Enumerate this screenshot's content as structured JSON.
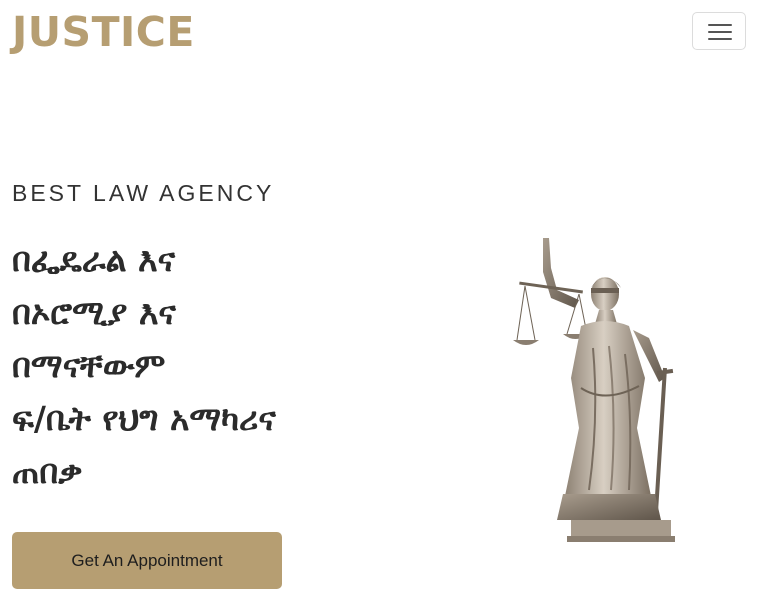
{
  "navbar": {
    "brand": "JUSTICE",
    "menu_toggle_icon": "hamburger-menu-icon"
  },
  "hero": {
    "eyebrow": "BEST LAW AGENCY",
    "headline_lines": [
      "በፌዴራል እና",
      "በኦሮሚያ እና",
      "በማናቸውም",
      "ፍ/ቤት የህግ አማካሪና",
      "ጠበቃ"
    ],
    "cta_label": "Get An Appointment",
    "image_subject": "lady-justice-statue"
  },
  "colors": {
    "brand_gold": "#b69e72",
    "text_dark": "#2b2b2b",
    "background": "#ffffff"
  }
}
